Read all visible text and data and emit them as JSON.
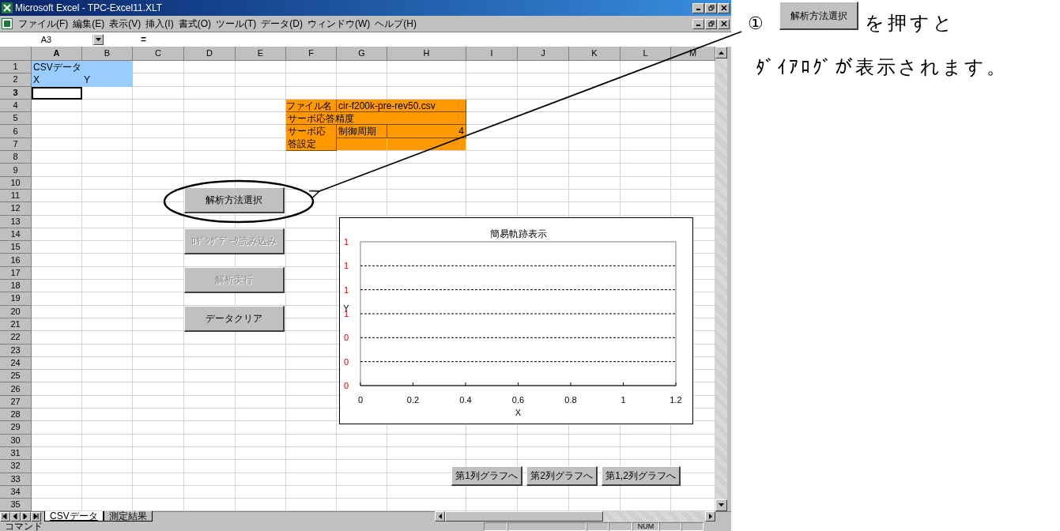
{
  "window": {
    "title": "Microsoft Excel - TPC-Excel11.XLT"
  },
  "menu": [
    "ファイル(F)",
    "編集(E)",
    "表示(V)",
    "挿入(I)",
    "書式(O)",
    "ツール(T)",
    "データ(D)",
    "ウィンドウ(W)",
    "ヘルプ(H)"
  ],
  "formula_bar": {
    "name_box": "A3",
    "equals": "="
  },
  "columns": [
    {
      "label": "A",
      "selected": true
    },
    {
      "label": "B",
      "selected": false
    },
    {
      "label": "C",
      "selected": false
    },
    {
      "label": "D",
      "selected": false
    },
    {
      "label": "E",
      "selected": false
    },
    {
      "label": "F",
      "selected": false
    },
    {
      "label": "G",
      "selected": false
    },
    {
      "label": "H",
      "selected": false
    },
    {
      "label": "I",
      "selected": false
    },
    {
      "label": "J",
      "selected": false
    },
    {
      "label": "K",
      "selected": false
    },
    {
      "label": "L",
      "selected": false
    },
    {
      "label": "M",
      "selected": false
    }
  ],
  "rows": [
    {
      "label": "1",
      "selected": false
    },
    {
      "label": "2",
      "selected": false
    },
    {
      "label": "3",
      "selected": true
    },
    {
      "label": "4",
      "selected": false
    },
    {
      "label": "5",
      "selected": false
    },
    {
      "label": "6",
      "selected": false
    },
    {
      "label": "7",
      "selected": false
    },
    {
      "label": "8",
      "selected": false
    },
    {
      "label": "9",
      "selected": false
    },
    {
      "label": "10",
      "selected": false
    },
    {
      "label": "11",
      "selected": false
    },
    {
      "label": "12",
      "selected": false
    },
    {
      "label": "13",
      "selected": false
    },
    {
      "label": "14",
      "selected": false
    },
    {
      "label": "15",
      "selected": false
    },
    {
      "label": "16",
      "selected": false
    },
    {
      "label": "17",
      "selected": false
    },
    {
      "label": "18",
      "selected": false
    },
    {
      "label": "19",
      "selected": false
    },
    {
      "label": "20",
      "selected": false
    },
    {
      "label": "21",
      "selected": false
    },
    {
      "label": "22",
      "selected": false
    },
    {
      "label": "23",
      "selected": false
    },
    {
      "label": "24",
      "selected": false
    },
    {
      "label": "25",
      "selected": false
    },
    {
      "label": "26",
      "selected": false
    },
    {
      "label": "27",
      "selected": false
    },
    {
      "label": "28",
      "selected": false
    },
    {
      "label": "29",
      "selected": false
    },
    {
      "label": "30",
      "selected": false
    },
    {
      "label": "31",
      "selected": false
    },
    {
      "label": "32",
      "selected": false
    },
    {
      "label": "33",
      "selected": false
    },
    {
      "label": "34",
      "selected": false
    },
    {
      "label": "35",
      "selected": false
    }
  ],
  "cells": [
    {
      "text": "CSVデータ"
    },
    {
      "text": "X"
    },
    {
      "text": "Y"
    },
    {
      "text": "ファイル名"
    },
    {
      "text": "cir-f200k-pre-rev50.csv"
    },
    {
      "text": "サーボ応答精度"
    },
    {
      "text": "サーボ応答設定"
    },
    {
      "text": "制御周期"
    },
    {
      "text": "4"
    }
  ],
  "buttons": [
    {
      "label": "解析方法選択",
      "disabled": false
    },
    {
      "label": "ﾛｷﾞﾝｸﾞﾃﾞｰﾀ読み込み",
      "disabled": true
    },
    {
      "label": "解析実行",
      "disabled": true
    },
    {
      "label": "データクリア",
      "disabled": false
    }
  ],
  "chart": {
    "chart_data": {
      "type": "line",
      "title": "簡易軌跡表示",
      "xlabel": "X",
      "ylabel": "Y",
      "grid": true,
      "xlim": [
        0,
        1.2
      ],
      "ylim": [
        0,
        1.2
      ],
      "xticks": [
        0,
        {
          "value": 0.2,
          "label": "0.2"
        },
        {
          "value": 0.4,
          "label": "0.4"
        },
        {
          "value": 0.6,
          "label": "0.6"
        },
        {
          "value": 0.8,
          "label": "0.8"
        },
        1,
        {
          "value": 1.2,
          "label": "1.2"
        }
      ],
      "yticks": [
        0,
        {
          "value": 0.2,
          "label": "0"
        },
        {
          "value": 0.4,
          "label": "0"
        },
        {
          "value": 0.6,
          "label": "1"
        },
        {
          "value": 0.8,
          "label": "1"
        },
        1,
        {
          "value": 1.2,
          "label": "1"
        }
      ]
    }
  },
  "graph_buttons": [
    "第1列グラフへ",
    "第2列グラフへ",
    "第1,2列グラフへ"
  ],
  "sheet_tabs": [
    {
      "label": "CSVデータ",
      "selected": true
    },
    {
      "label": "測定結果",
      "selected": false
    }
  ],
  "status_bar": {
    "mode": "コマンド",
    "indicator": "NUM"
  },
  "annotation": {
    "number": "①",
    "button": "解析方法選択",
    "line_1": "を押すと",
    "line_2": "ﾀﾞｲｱﾛｸﾞが表示されます。"
  }
}
